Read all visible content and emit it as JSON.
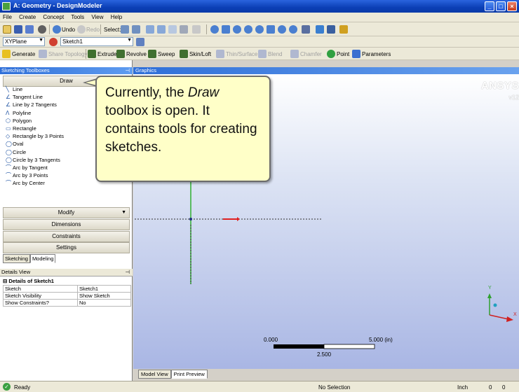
{
  "window": {
    "title": "A: Geometry - DesignModeler",
    "min_glyph": "_",
    "max_glyph": "□",
    "close_glyph": "×"
  },
  "menu": [
    "File",
    "Create",
    "Concept",
    "Tools",
    "View",
    "Help"
  ],
  "toolbar1": {
    "undo_label": "Undo",
    "redo_label": "Redo",
    "select_label": "Select:"
  },
  "toolbar2": {
    "plane_value": "XYPlane",
    "sketch_value": "Sketch1"
  },
  "toolbar3": {
    "generate": "Generate",
    "share_topology": "Share Topology",
    "extrude": "Extrude",
    "revolve": "Revolve",
    "sweep": "Sweep",
    "skin_loft": "Skin/Loft",
    "thin_surface": "Thin/Surface",
    "blend": "Blend",
    "chamfer": "Chamfer",
    "point": "Point",
    "parameters": "Parameters"
  },
  "sketching_toolboxes": {
    "title": "Sketching Toolboxes",
    "draw_header": "Draw",
    "tools": [
      {
        "icon": "╲",
        "label": "Line"
      },
      {
        "icon": "∠",
        "label": "Tangent Line"
      },
      {
        "icon": "∠",
        "label": "Line by 2 Tangents"
      },
      {
        "icon": "Λ",
        "label": "Polyline"
      },
      {
        "icon": "⬡",
        "label": "Polygon"
      },
      {
        "icon": "▭",
        "label": "Rectangle"
      },
      {
        "icon": "◇",
        "label": "Rectangle by 3 Points"
      },
      {
        "icon": "◯",
        "label": "Oval"
      },
      {
        "icon": "◯",
        "label": "Circle"
      },
      {
        "icon": "◯",
        "label": "Circle by 3 Tangents"
      },
      {
        "icon": "⌒",
        "label": "Arc by Tangent"
      },
      {
        "icon": "⌒",
        "label": "Arc by 3 Points"
      },
      {
        "icon": "⌒",
        "label": "Arc by Center"
      }
    ],
    "modify_header": "Modify",
    "dimensions_header": "Dimensions",
    "constraints_header": "Constraints",
    "settings_header": "Settings",
    "tabs": [
      "Sketching",
      "Modeling"
    ]
  },
  "details_view": {
    "title": "Details View",
    "group": "Details of Sketch1",
    "rows": [
      {
        "key": "Sketch",
        "value": "Sketch1"
      },
      {
        "key": "Sketch Visibility",
        "value": "Show Sketch"
      },
      {
        "key": "Show Constraints?",
        "value": "No"
      }
    ]
  },
  "graphics": {
    "title": "Graphics",
    "brand": "ANSYS",
    "version": "v12",
    "callout": {
      "part1": "Currently, the ",
      "emph": "Draw",
      "part2": " toolbox is open.  It contains tools for creating sketches."
    },
    "scale": {
      "left": "0.000",
      "right": "5.000 (in)",
      "mid": "2.500"
    },
    "axis_y": "Y",
    "axis_x": "X",
    "view_tabs": [
      "Model View",
      "Print Preview"
    ]
  },
  "status": {
    "ready": "Ready",
    "selection": "No Selection",
    "units": "Inch",
    "val1": "0",
    "val2": "0"
  },
  "colors": {
    "accent": "#2f6fd8",
    "callout_bg": "#ffffc8",
    "x_axis": "#e02020",
    "y_axis": "#20a020"
  }
}
